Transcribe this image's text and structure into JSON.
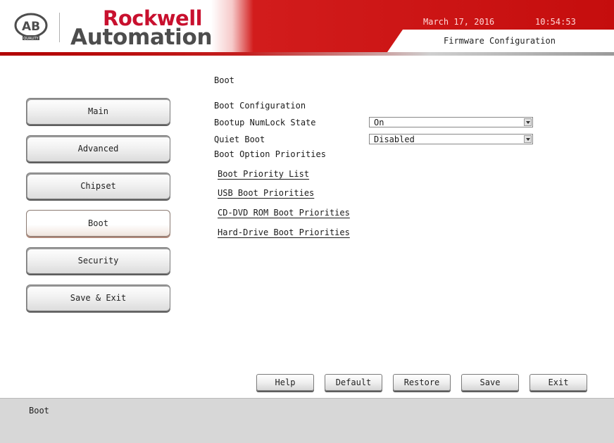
{
  "header": {
    "brand_line1": "Rockwell",
    "brand_line2": "Automation",
    "logo_text": "AB",
    "logo_sub": "QUALITY",
    "date": "March 17, 2016",
    "time": "10:54:53",
    "title": "Firmware Configuration",
    "brand_color": "#c8102e"
  },
  "sidebar": {
    "items": [
      {
        "label": "Main",
        "active": false
      },
      {
        "label": "Advanced",
        "active": false
      },
      {
        "label": "Chipset",
        "active": false
      },
      {
        "label": "Boot",
        "active": true
      },
      {
        "label": "Security",
        "active": false
      },
      {
        "label": "Save & Exit",
        "active": false
      }
    ]
  },
  "main": {
    "page_title": "Boot",
    "section_config": "Boot Configuration",
    "numlock_label": "Bootup NumLock State",
    "numlock_value": "On",
    "quiet_label": "Quiet Boot",
    "quiet_value": "Disabled",
    "priorities_label": "Boot Option Priorities",
    "links": [
      "Boot Priority List",
      "USB Boot Priorities",
      "CD-DVD ROM Boot Priorities",
      "Hard-Drive Boot Priorities"
    ]
  },
  "buttons": {
    "help": "Help",
    "default": "Default",
    "restore": "Restore",
    "save": "Save",
    "exit": "Exit"
  },
  "status": {
    "text": "Boot"
  }
}
